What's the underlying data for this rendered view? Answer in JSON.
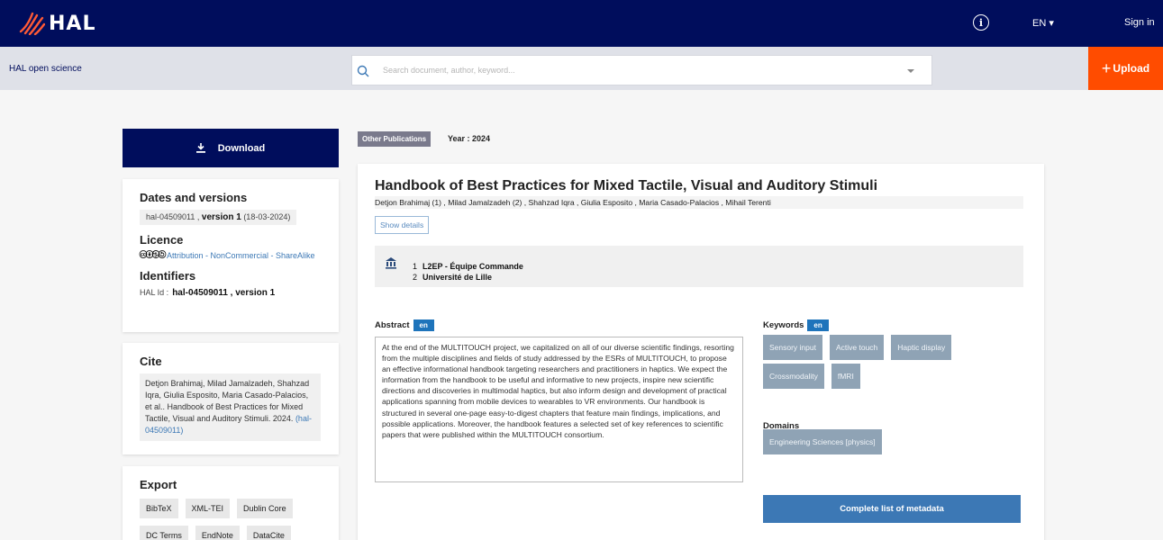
{
  "header": {
    "logo_text": "HAL",
    "info_glyph": "i",
    "lang": "EN ▾",
    "signin": "Sign in"
  },
  "subbar": {
    "brand": "HAL open science",
    "search_placeholder": "Search document, author, keyword...",
    "upload_plus": "+",
    "upload_label": "Upload"
  },
  "sidebar": {
    "download_label": "Download",
    "dates_title": "Dates and versions",
    "version_id": "hal-04509011 , ",
    "version_label": "version 1",
    "version_date": " (18-03-2024)",
    "licence_title": "Licence",
    "licence_icons": "🅭🅯🄏🄎",
    "licence_text": "Attribution - NonCommercial - ShareAlike",
    "identifiers_title": "Identifiers",
    "halid_label": "HAL Id :",
    "halid_value": "hal-04509011 , version 1",
    "cite_title": "Cite",
    "cite_text": "Detjon Brahimaj, Milad Jamalzadeh, Shahzad Iqra, Giulia Esposito, Maria Casado-Palacios, et al.. Handbook of Best Practices for Mixed Tactile, Visual and Auditory Stimuli. 2024. ",
    "cite_link": "(hal-04509011)",
    "export_title": "Export",
    "export_buttons": [
      "BibTeX",
      "XML-TEI",
      "Dublin Core",
      "DC Terms",
      "EndNote",
      "DataCite"
    ]
  },
  "main": {
    "type_tag": "Other Publications",
    "year": "Year : 2024",
    "title": "Handbook of Best Practices for Mixed Tactile, Visual and Auditory Stimuli",
    "authors": "Detjon Brahimaj (1) , Milad Jamalzadeh (2) , Shahzad Iqra , Giulia Esposito , Maria Casado-Palacios , Mihail Terenti",
    "show_details": "Show details",
    "affiliations": [
      {
        "n": "1",
        "name": "L2EP - Équipe Commande"
      },
      {
        "n": "2",
        "name": "Université de Lille"
      }
    ],
    "abstract_label": "Abstract",
    "abstract_lang": "en",
    "abstract": "At the end of the MULTITOUCH project, we capitalized on all of our diverse scientific findings, resorting from the multiple disciplines and fields of study addressed by the ESRs of MULTITOUCH, to propose an effective informational handbook targeting researchers and practitioners in haptics. We expect the information from the handbook to be useful and informative to new projects, inspire new scientific directions and discoveries in multimodal haptics, but also inform design and development of practical applications spanning from mobile devices to wearables to VR environments. Our handbook is structured in several one-page easy-to-digest chapters that feature main findings, implications, and possible applications. Moreover, the handbook features a selected set of key references to scientific papers that were published within the MULTITOUCH consortium.",
    "keywords_label": "Keywords",
    "keywords_lang": "en",
    "keywords": [
      "Sensory input",
      "Active touch",
      "Haptic display",
      "Crossmodality",
      "fMRI"
    ],
    "domains_label": "Domains",
    "domains": [
      "Engineering Sciences [physics]"
    ],
    "metadata_button": "Complete list of metadata"
  },
  "colors": {
    "navy": "#000d5c",
    "upload_orange": "#ff4c00",
    "accent_blue": "#3c78b5",
    "chip_gray": "#8fa3b5"
  }
}
